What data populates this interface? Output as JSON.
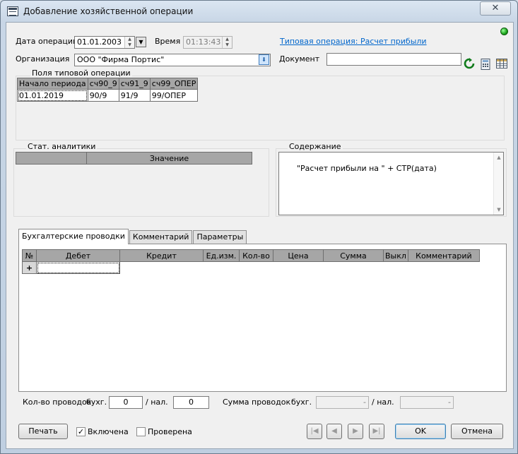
{
  "window": {
    "title": "Добавление хозяйственной операции",
    "close_glyph": "✕"
  },
  "header": {
    "date_label": "Дата операции",
    "date_value": "01.01.2003",
    "time_label": "Время",
    "time_value": "01:13:43",
    "template_link": "Типовая операция: Расчет прибыли",
    "org_label": "Организация",
    "org_value": "ООО \"Фирма Портис\"",
    "doc_label": "Документ",
    "doc_value": "",
    "status_color": "#19a319"
  },
  "template_fields": {
    "title": "Поля типовой операции",
    "columns": [
      "Начало периода",
      "сч90_9",
      "сч91_9",
      "сч99_ОПЕР"
    ],
    "rows": [
      [
        "01.01.2019",
        "90/9",
        "91/9",
        "99/ОПЕР"
      ]
    ]
  },
  "stat": {
    "title": "Стат. аналитики",
    "columns": [
      "",
      "Значение"
    ]
  },
  "content": {
    "title": "Содержание",
    "text": "\"Расчет прибыли на \" + СТР(дата)"
  },
  "tabs": [
    {
      "label": "Бухгалтерские проводки",
      "active": true
    },
    {
      "label": "Комментарий",
      "active": false
    },
    {
      "label": "Параметры",
      "active": false
    }
  ],
  "postings": {
    "columns": [
      "№",
      "Дебет",
      "Кредит",
      "Ед.изм.",
      "Кол-во",
      "Цена",
      "Сумма",
      "Выкл",
      "Комментарий"
    ],
    "new_row_marker": "+"
  },
  "totals": {
    "count_label": "Кол-во проводок",
    "buh_label": "бухг.",
    "count_buh": "0",
    "slash_nal_label": "/  нал.",
    "count_nal": "0",
    "sum_label": "Сумма проводок",
    "sum_buh_label": "бухг.",
    "sum_buh": "-",
    "sum_slash_nal_label": "/  нал.",
    "sum_nal": "-"
  },
  "footer": {
    "print_label": "Печать",
    "included_label": "Включена",
    "included_checked": true,
    "checked_label": "Проверена",
    "checked_checked": false,
    "ok_label": "OK",
    "cancel_label": "Отмена"
  }
}
